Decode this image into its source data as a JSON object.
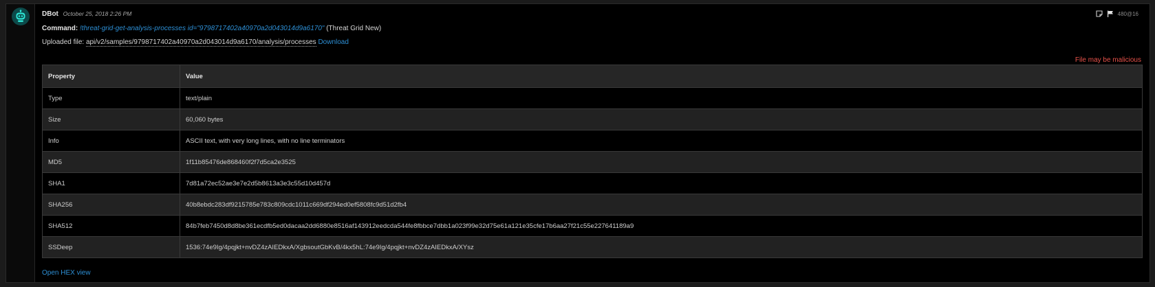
{
  "message": {
    "author": "DBot",
    "timestamp": "October 25, 2018 2:26 PM",
    "entry_id": "480@16",
    "command_label": "Command:",
    "command": "!threat-grid-get-analysis-processes id=\"9798717402a40970a2d043014d9a6170\"",
    "command_source": "(Threat Grid New)",
    "uploaded_label": "Uploaded file:",
    "uploaded_path": "api/v2/samples/9798717402a40970a2d043014d9a6170/analysis/processes",
    "download_label": "Download",
    "warning": "File may be malicious",
    "hex_link": "Open HEX view"
  },
  "table": {
    "headers": [
      "Property",
      "Value"
    ],
    "rows": [
      {
        "property": "Type",
        "value": "text/plain"
      },
      {
        "property": "Size",
        "value": "60,060 bytes"
      },
      {
        "property": "Info",
        "value": "ASCII text, with very long lines, with no line terminators"
      },
      {
        "property": "MD5",
        "value": "1f11b85476de868460f2f7d5ca2e3525"
      },
      {
        "property": "SHA1",
        "value": "7d81a72ec52ae3e7e2d5b8613a3e3c55d10d457d"
      },
      {
        "property": "SHA256",
        "value": "40b8ebdc283df9215785e783c809cdc1011c669df294ed0ef5808fc9d51d2fb4"
      },
      {
        "property": "SHA512",
        "value": "84b7feb7450d8d8be361ecdfb5ed0dacaa2dd6880e8516af143912eedcda544fe8fbbce7dbb1a023f99e32d75e61a121e35cfe17b6aa27f21c55e227641189a9"
      },
      {
        "property": "SSDeep",
        "value": "1536:74e9Ig/4pqjkt+nvDZ4zAIEDkxA/XgbsoutGbKvB/4kx5hL:74e9Ig/4pqjkt+nvDZ4zAIEDkxA/XYsz"
      }
    ]
  },
  "colors": {
    "link": "#2d8fd5",
    "warning": "#e8524a",
    "avatar": "#0c4a4a"
  },
  "icons": [
    "bot-avatar-icon",
    "note-icon",
    "flag-icon"
  ]
}
